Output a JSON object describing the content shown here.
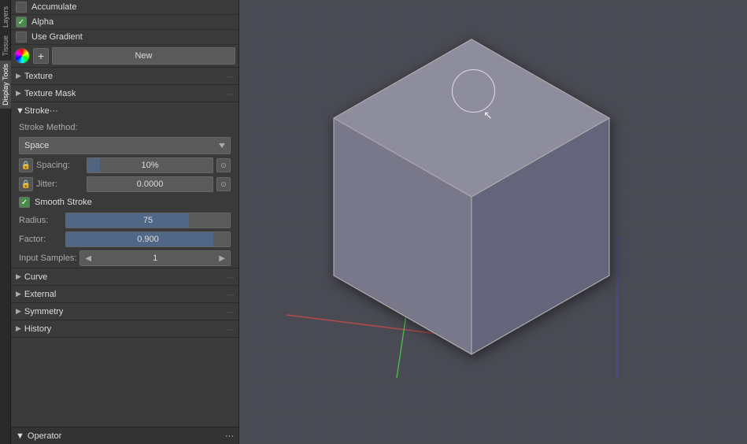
{
  "vtabs": {
    "items": [
      "Layers",
      "Tissue",
      "Display Tools"
    ]
  },
  "panel": {
    "accumulate_label": "Accumulate",
    "alpha_label": "Alpha",
    "use_gradient_label": "Use Gradient",
    "new_button_label": "New",
    "texture_label": "Texture",
    "texture_mask_label": "Texture Mask",
    "stroke_label": "Stroke",
    "stroke_method_label": "Stroke Method:",
    "space_option": "Space",
    "spacing_label": "Spacing:",
    "spacing_value": "10%",
    "jitter_label": "Jitter:",
    "jitter_value": "0.0000",
    "smooth_stroke_label": "Smooth Stroke",
    "radius_label": "Radius:",
    "radius_value": "75",
    "radius_percent": 75,
    "factor_label": "Factor:",
    "factor_value": "0.900",
    "factor_percent": 90,
    "input_samples_label": "Input Samples:",
    "input_samples_value": "1",
    "curve_label": "Curve",
    "external_label": "External",
    "symmetry_label": "Symmetry",
    "history_label": "History",
    "operator_label": "Operator",
    "dots_symbol": "···"
  }
}
